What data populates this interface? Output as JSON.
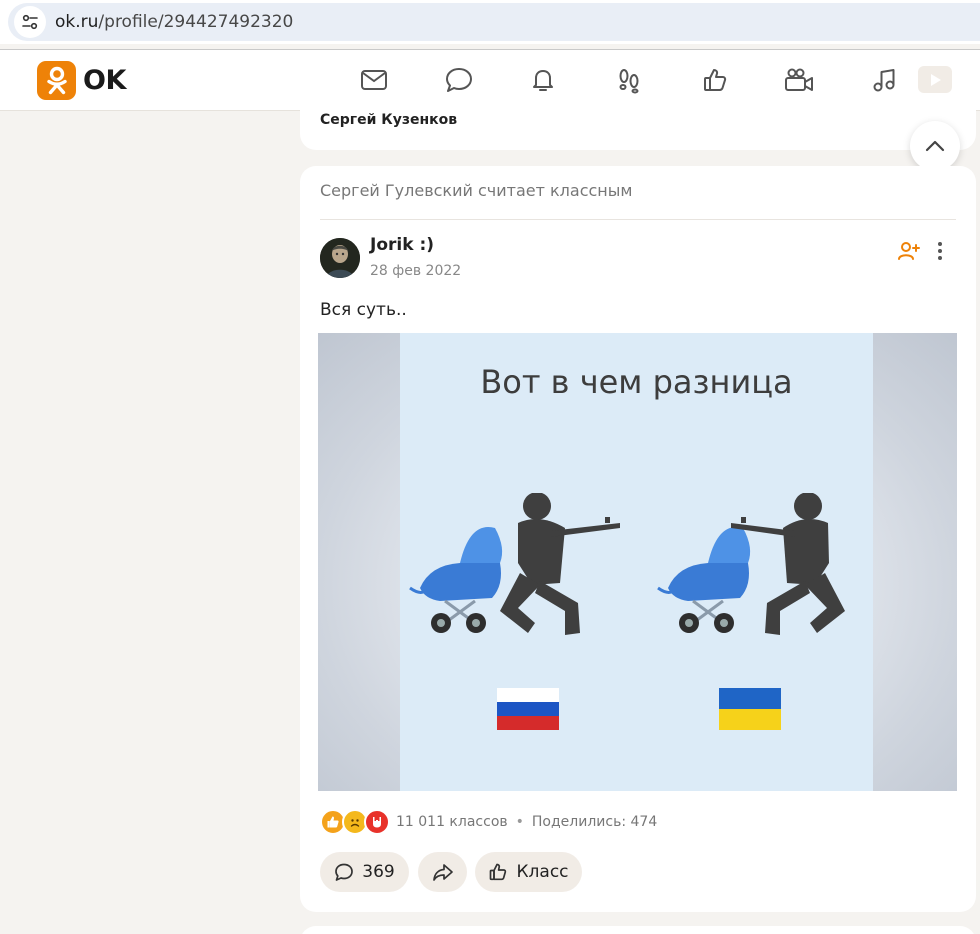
{
  "browser": {
    "url_domain": "ok.ru",
    "url_path": "/profile/294427492320"
  },
  "header": {
    "logo_text": "OK",
    "brand_color": "#ee8208",
    "nav": [
      "mail-icon",
      "chat-icon",
      "bell-icon",
      "footprints-icon",
      "like-icon",
      "video-camera-icon",
      "music-icon",
      "video-play-icon"
    ]
  },
  "previous_post": {
    "author": "Сергей Кузенков"
  },
  "post": {
    "feed_reason": "Сергей Гулевский считает классным",
    "author": "Jorik :)",
    "date": "28 фев 2022",
    "text": "Вся суть..",
    "image_caption": "Вот в чем разница",
    "likes": "11 011 классов",
    "separator": "•",
    "shares": "Поделились: 474",
    "reactions": [
      "like",
      "sad",
      "rock"
    ],
    "comments_count": "369",
    "like_button": "Класс"
  }
}
